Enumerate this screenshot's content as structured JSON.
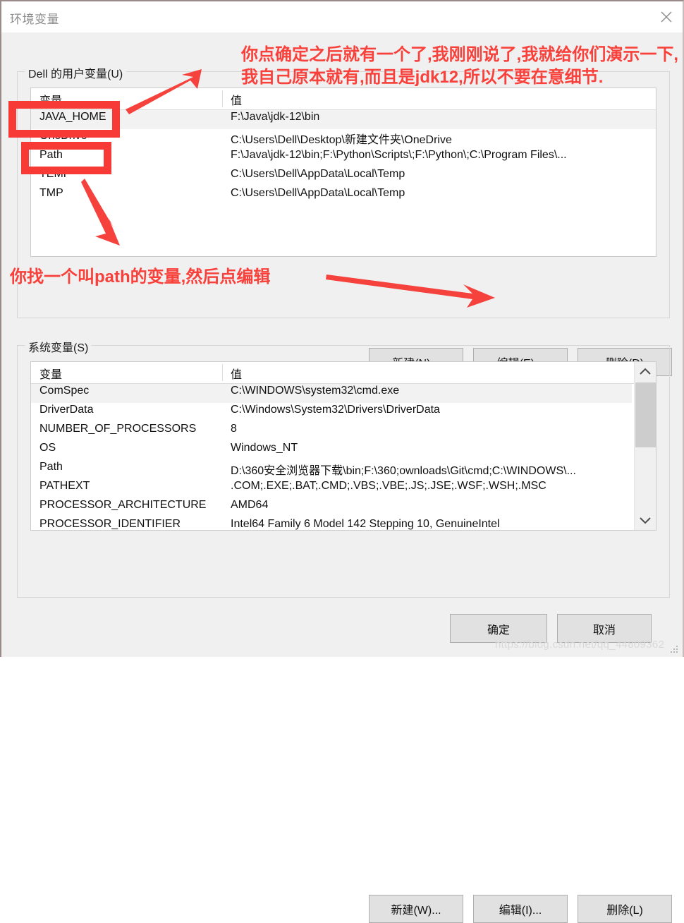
{
  "window": {
    "title": "环境变量",
    "close_icon": "close-icon"
  },
  "user_section": {
    "legend": "Dell 的用户变量(U)",
    "columns": {
      "name": "变量",
      "value": "值"
    },
    "rows": [
      {
        "name": "JAVA_HOME",
        "value": "F:\\Java\\jdk-12\\bin",
        "selected": true
      },
      {
        "name": "OneDrive",
        "value": "C:\\Users\\Dell\\Desktop\\新建文件夹\\OneDrive",
        "selected": false
      },
      {
        "name": "Path",
        "value": "F:\\Java\\jdk-12\\bin;F:\\Python\\Scripts\\;F:\\Python\\;C:\\Program Files\\...",
        "selected": false
      },
      {
        "name": "TEMP",
        "value": "C:\\Users\\Dell\\AppData\\Local\\Temp",
        "selected": false
      },
      {
        "name": "TMP",
        "value": "C:\\Users\\Dell\\AppData\\Local\\Temp",
        "selected": false
      }
    ],
    "buttons": {
      "new": "新建(N)...",
      "edit": "编辑(E)...",
      "delete": "删除(D)"
    }
  },
  "system_section": {
    "legend": "系统变量(S)",
    "columns": {
      "name": "变量",
      "value": "值"
    },
    "rows": [
      {
        "name": "ComSpec",
        "value": "C:\\WINDOWS\\system32\\cmd.exe",
        "selected": true
      },
      {
        "name": "DriverData",
        "value": "C:\\Windows\\System32\\Drivers\\DriverData",
        "selected": false
      },
      {
        "name": "NUMBER_OF_PROCESSORS",
        "value": "8",
        "selected": false
      },
      {
        "name": "OS",
        "value": "Windows_NT",
        "selected": false
      },
      {
        "name": "Path",
        "value": "D:\\360安全浏览器下载\\bin;F:\\360;ownloads\\Git\\cmd;C:\\WINDOWS\\...",
        "selected": false
      },
      {
        "name": "PATHEXT",
        "value": ".COM;.EXE;.BAT;.CMD;.VBS;.VBE;.JS;.JSE;.WSF;.WSH;.MSC",
        "selected": false
      },
      {
        "name": "PROCESSOR_ARCHITECTURE",
        "value": "AMD64",
        "selected": false
      },
      {
        "name": "PROCESSOR_IDENTIFIER",
        "value": "Intel64 Family 6 Model 142 Stepping 10, GenuineIntel",
        "selected": false
      }
    ],
    "buttons": {
      "new": "新建(W)...",
      "edit": "编辑(I)...",
      "delete": "删除(L)"
    },
    "scrollbar": {
      "up_icon": "chevron-up-icon",
      "down_icon": "chevron-down-icon"
    }
  },
  "dialog_buttons": {
    "ok": "确定",
    "cancel": "取消"
  },
  "annotations": {
    "top_note": "你点确定之后就有一个了,我刚刚说了,我就给你们演示一下,我自己原本就有,而且是jdk12,所以不要在意细节.",
    "bottom_note": "你找一个叫path的变量,然后点编辑",
    "highlight_color": "#f73a35",
    "text_color": "#f9413c"
  },
  "watermark": "https://blog.csdn.net/qq_44809362"
}
